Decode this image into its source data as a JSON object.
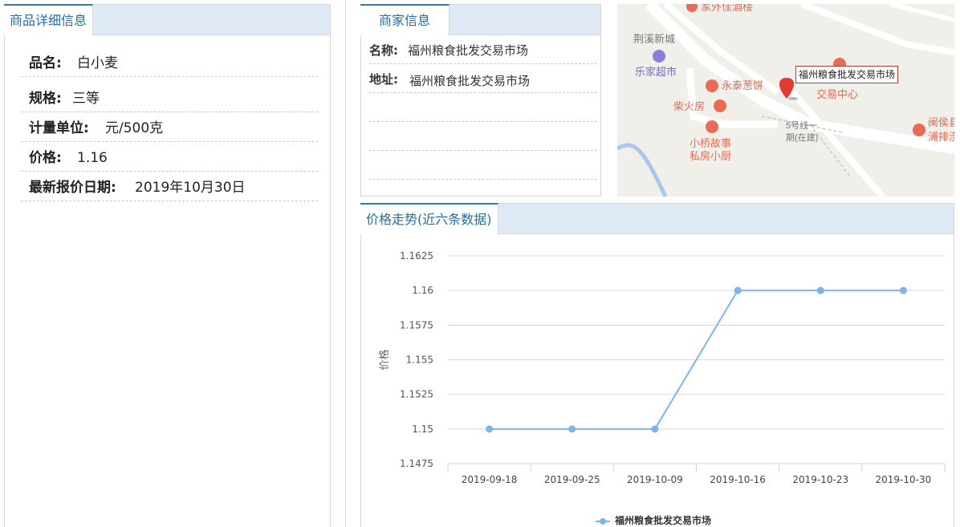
{
  "product_panel": {
    "tab_label": "商品详细信息",
    "rows": [
      {
        "label": "品名:",
        "value": "白小麦"
      },
      {
        "label": "规格:",
        "value": "三等"
      },
      {
        "label": "计量单位:",
        "value": "元/500克"
      },
      {
        "label": "价格:",
        "value": "1.16"
      },
      {
        "label": "最新报价日期:",
        "value": "2019年10月30日"
      }
    ]
  },
  "merchant_panel": {
    "tab_label": "商家信息",
    "rows": [
      {
        "label": "名称:",
        "value": "福州粮食批发交易市场"
      },
      {
        "label": "地址:",
        "value": "福州粮食批发交易市场"
      }
    ]
  },
  "map": {
    "callout": "福州粮食批发交易市场",
    "labels": [
      "家外佳酒楼",
      "荆溪新城",
      "乐家超市",
      "永泰葱饼",
      "柴火房",
      "小桥故事",
      "私房小厨",
      "交易中心",
      "5号线一",
      "期(在建)",
      "闽侯县",
      "浦排涝"
    ],
    "colors": {
      "road": "#ffffff",
      "poi": "#e86b52",
      "shop": "#8e7fd6",
      "marker": "#e23a2f",
      "water": "#a8c6f0"
    }
  },
  "trend_panel": {
    "tab_label": "价格走势(近六条数据)"
  },
  "chart_data": {
    "type": "line",
    "categories": [
      "2019-09-18",
      "2019-09-25",
      "2019-10-09",
      "2019-10-16",
      "2019-10-23",
      "2019-10-30"
    ],
    "series": [
      {
        "name": "福州粮食批发交易市场",
        "values": [
          1.15,
          1.15,
          1.15,
          1.16,
          1.16,
          1.16
        ]
      }
    ],
    "y_ticks": [
      "1.1625",
      "1.16",
      "1.1575",
      "1.155",
      "1.1525",
      "1.15",
      "1.1475"
    ],
    "ylim": [
      1.1475,
      1.1625
    ],
    "ylabel": "价格",
    "xlabel": "",
    "grid": true,
    "legend": "bottom-center",
    "line_color": "#7cb5ec"
  }
}
